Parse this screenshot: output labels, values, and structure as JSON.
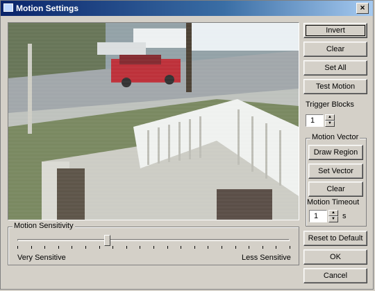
{
  "window": {
    "title": "Motion Settings",
    "close_glyph": "×"
  },
  "buttons": {
    "invert": "Invert",
    "clear": "Clear",
    "set_all": "Set All",
    "test_motion": "Test Motion",
    "draw_region": "Draw Region",
    "set_vector": "Set Vector",
    "vector_clear": "Clear",
    "reset_default": "Reset to Default",
    "ok": "OK",
    "cancel": "Cancel"
  },
  "trigger_blocks": {
    "label": "Trigger Blocks",
    "value": "1"
  },
  "motion_vector": {
    "group_title": "Motion Vector"
  },
  "motion_timeout": {
    "label": "Motion Timeout",
    "value": "1",
    "unit": "s"
  },
  "sensitivity": {
    "group_title": "Motion Sensitivity",
    "min_label": "Very Sensitive",
    "max_label": "Less Sensitive",
    "level_fraction": 0.33
  }
}
